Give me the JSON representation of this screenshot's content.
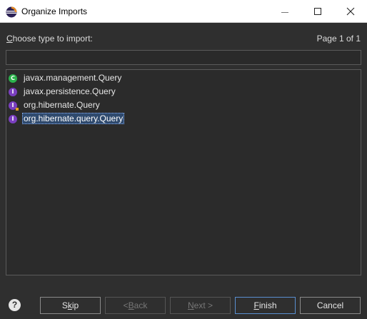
{
  "window": {
    "title": "Organize Imports",
    "app_icon": "eclipse-icon"
  },
  "prompt": {
    "label": "Choose type to import:",
    "mnemonic": "C",
    "rest": "hoose type to import:"
  },
  "page_info": "Page 1 of 1",
  "filter": {
    "value": ""
  },
  "types": [
    {
      "name": "javax.management.Query",
      "kind": "class",
      "icon": "class-icon",
      "badge": "C"
    },
    {
      "name": "javax.persistence.Query",
      "kind": "interface",
      "icon": "interface-icon",
      "badge": "I"
    },
    {
      "name": "org.hibernate.Query",
      "kind": "interface-deprecated",
      "icon": "interface-deprecated-icon",
      "badge": "I"
    },
    {
      "name": "org.hibernate.query.Query",
      "kind": "interface",
      "icon": "interface-icon",
      "badge": "I",
      "selected": true
    }
  ],
  "buttons": {
    "skip": {
      "mnemonic": "k",
      "pre": "S",
      "post": "ip"
    },
    "back": {
      "pre": "< ",
      "mnemonic": "B",
      "post": "ack",
      "disabled": true
    },
    "next": {
      "mnemonic": "N",
      "post": "ext >",
      "disabled": true
    },
    "finish": {
      "mnemonic": "F",
      "post": "inish"
    },
    "cancel": {
      "label": "Cancel"
    }
  },
  "help_glyph": "?",
  "colors": {
    "background": "#2f2f2f",
    "class_icon": "#2bb24c",
    "interface_icon": "#7a3fbf",
    "selection": "#2f4a6e"
  }
}
